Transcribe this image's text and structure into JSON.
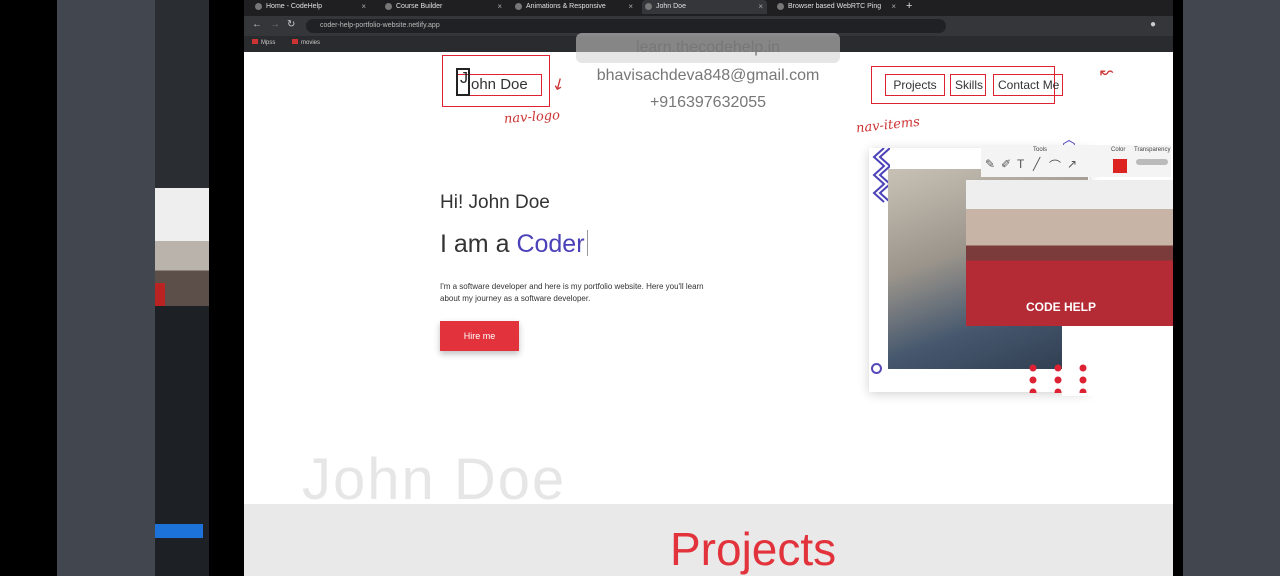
{
  "side_strip": {
    "top_text": "",
    "tile_label": ""
  },
  "browser": {
    "tabs": [
      {
        "label": "Home - CodeHelp"
      },
      {
        "label": "Course Builder"
      },
      {
        "label": "Animations & Responsive"
      },
      {
        "label": "John Doe"
      },
      {
        "label": "Browser based WebRTC Ping"
      }
    ],
    "new_tab": "+",
    "url": "coder-help-portfolio-website.netlify.app",
    "bookmarks": [
      {
        "label": "Mpss"
      },
      {
        "label": "movies"
      }
    ]
  },
  "overlay": {
    "line1": "learn.thecodehelp.in",
    "line2": "bhavisachdeva848@gmail.com",
    "line3": "+916397632055"
  },
  "site": {
    "logo_initial": "J",
    "logo_text": "ohn Doe",
    "nav": {
      "projects": "Projects",
      "skills": "Skills",
      "contact": "Contact Me"
    },
    "greeting": "Hi! John Doe",
    "headline_prefix": "I am a",
    "headline_highlight": "Coder",
    "intro": "I'm a software developer and here is my portfolio website. Here you'll learn about my journey as a software developer.",
    "hire_button": "Hire me",
    "ghost_name": "John Doe",
    "projects_title": "Projects",
    "brand_shirt": "CODE HELP"
  },
  "annotations": {
    "nav_logo": "nav-logo",
    "nav_items": "nav-items"
  },
  "toolpanel": {
    "tools_label": "Tools",
    "color_label": "Color",
    "transparency_label": "Transparency"
  },
  "colors": {
    "accent_red": "#e2323b",
    "accent_purple": "#4b41b8",
    "annotation_red": "#d22233"
  }
}
